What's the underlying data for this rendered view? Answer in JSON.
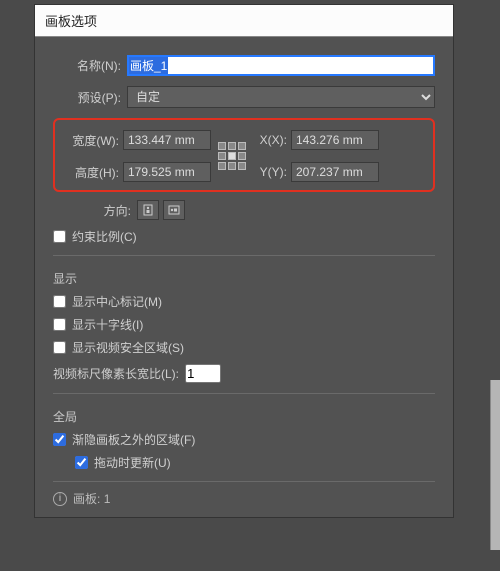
{
  "dialog": {
    "title": "画板选项",
    "name_label": "名称(N):",
    "name_value": "画板_1",
    "preset_label": "预设(P):",
    "preset_value": "自定",
    "width_label": "宽度(W):",
    "width_value": "133.447 mm",
    "height_label": "高度(H):",
    "height_value": "179.525 mm",
    "x_label": "X(X):",
    "x_value": "143.276 mm",
    "y_label": "Y(Y):",
    "y_value": "207.237 mm",
    "orient_label": "方向:",
    "constrain_label": "约束比例(C)",
    "constrain_checked": false
  },
  "display": {
    "section": "显示",
    "center_mark_label": "显示中心标记(M)",
    "center_mark_checked": false,
    "cross_label": "显示十字线(I)",
    "cross_checked": false,
    "safe_label": "显示视频安全区域(S)",
    "safe_checked": false,
    "ratio_label": "视频标尺像素长宽比(L):",
    "ratio_value": "1"
  },
  "global": {
    "section": "全局",
    "fade_label": "渐隐画板之外的区域(F)",
    "fade_checked": true,
    "drag_label": "拖动时更新(U)",
    "drag_checked": true
  },
  "footer": {
    "artboard_label": "画板:",
    "artboard_count": "1"
  }
}
